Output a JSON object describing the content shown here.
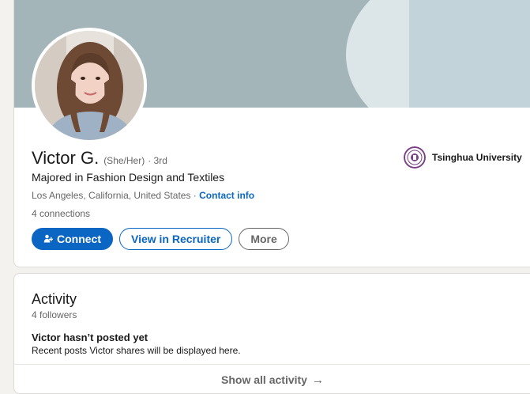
{
  "profile": {
    "name": "Victor G.",
    "pronouns": "(She/Her)",
    "degree": "· 3rd",
    "headline": "Majored in Fashion Design and Textiles",
    "location": "Los Angeles, California, United States ·",
    "contact_info": "Contact info",
    "connections": "4 connections",
    "education": {
      "name": "Tsinghua University",
      "logo_icon": "tsinghua-seal-icon"
    },
    "buttons": {
      "connect": "Connect",
      "view_in_recruiter": "View in Recruiter",
      "more": "More"
    }
  },
  "activity": {
    "title": "Activity",
    "followers": "4 followers",
    "empty_title": "Victor hasn’t posted yet",
    "empty_desc": "Recent posts Victor shares will be displayed here.",
    "show_all": "Show all activity"
  },
  "colors": {
    "accent": "#0a66c2",
    "cover": "#a3b5b9",
    "seal": "#7a3f86"
  }
}
